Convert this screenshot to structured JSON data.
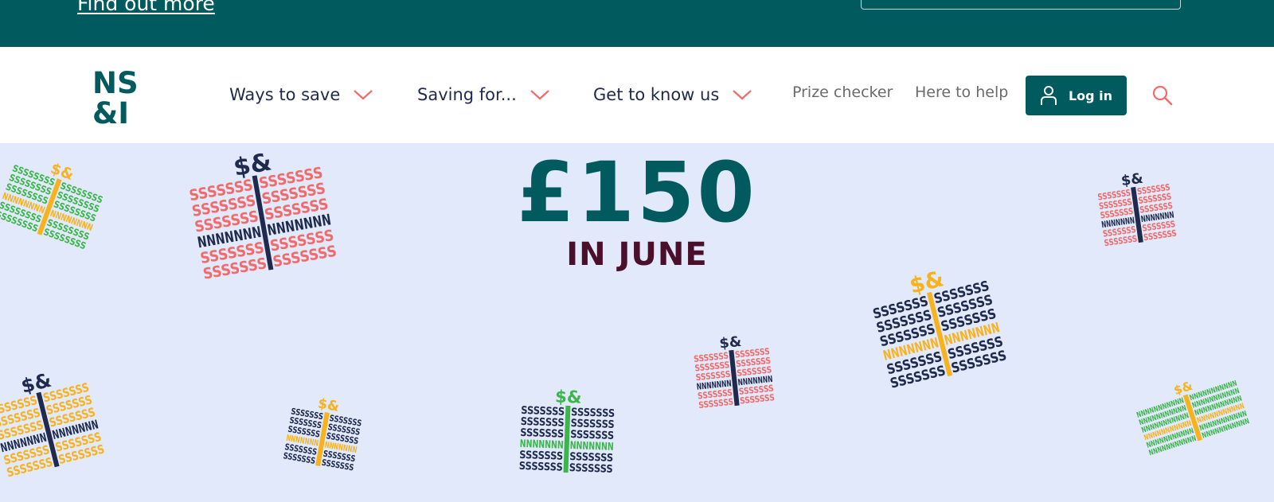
{
  "promo_banner": {
    "link_label": "Find out more"
  },
  "header": {
    "logo_alt": "NS&I",
    "nav": [
      {
        "label": "Ways to save"
      },
      {
        "label": "Saving for..."
      },
      {
        "label": "Get to know us"
      }
    ],
    "links": [
      {
        "label": "Prize checker"
      },
      {
        "label": "Here to help"
      }
    ],
    "login_label": "Log in"
  },
  "hero": {
    "amount": "£150",
    "subtitle": "IN JUNE"
  },
  "colors": {
    "brand_teal": "#005a5e",
    "navy": "#1f2a4d",
    "accent_coral": "#f26b6b",
    "yellow": "#f8b21e",
    "green": "#3cb54a",
    "hero_bg": "#e1e9fb",
    "maroon": "#4a0f2a"
  },
  "icons": {
    "chevron": "chevron-down-icon",
    "user": "user-icon",
    "search": "search-icon"
  }
}
